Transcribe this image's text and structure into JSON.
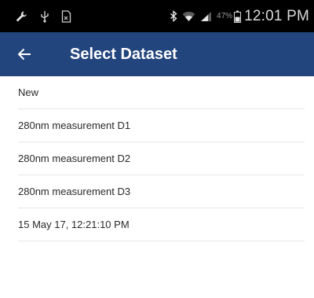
{
  "status_bar": {
    "left_icons": [
      "wrench-icon",
      "usb-icon",
      "file-icon"
    ],
    "right_icons": [
      "bluetooth-icon",
      "wifi-icon",
      "signal-icon",
      "battery-icon"
    ],
    "battery_percent": "47%",
    "time": "12:01 PM"
  },
  "app_bar": {
    "back_icon": "arrow-left-icon",
    "title": "Select Dataset",
    "color": "#23457e"
  },
  "datasets": [
    {
      "label": "New"
    },
    {
      "label": "280nm measurement D1"
    },
    {
      "label": "280nm measurement D2"
    },
    {
      "label": "280nm measurement D3"
    },
    {
      "label": "15 May 17, 12:21:10 PM"
    }
  ]
}
